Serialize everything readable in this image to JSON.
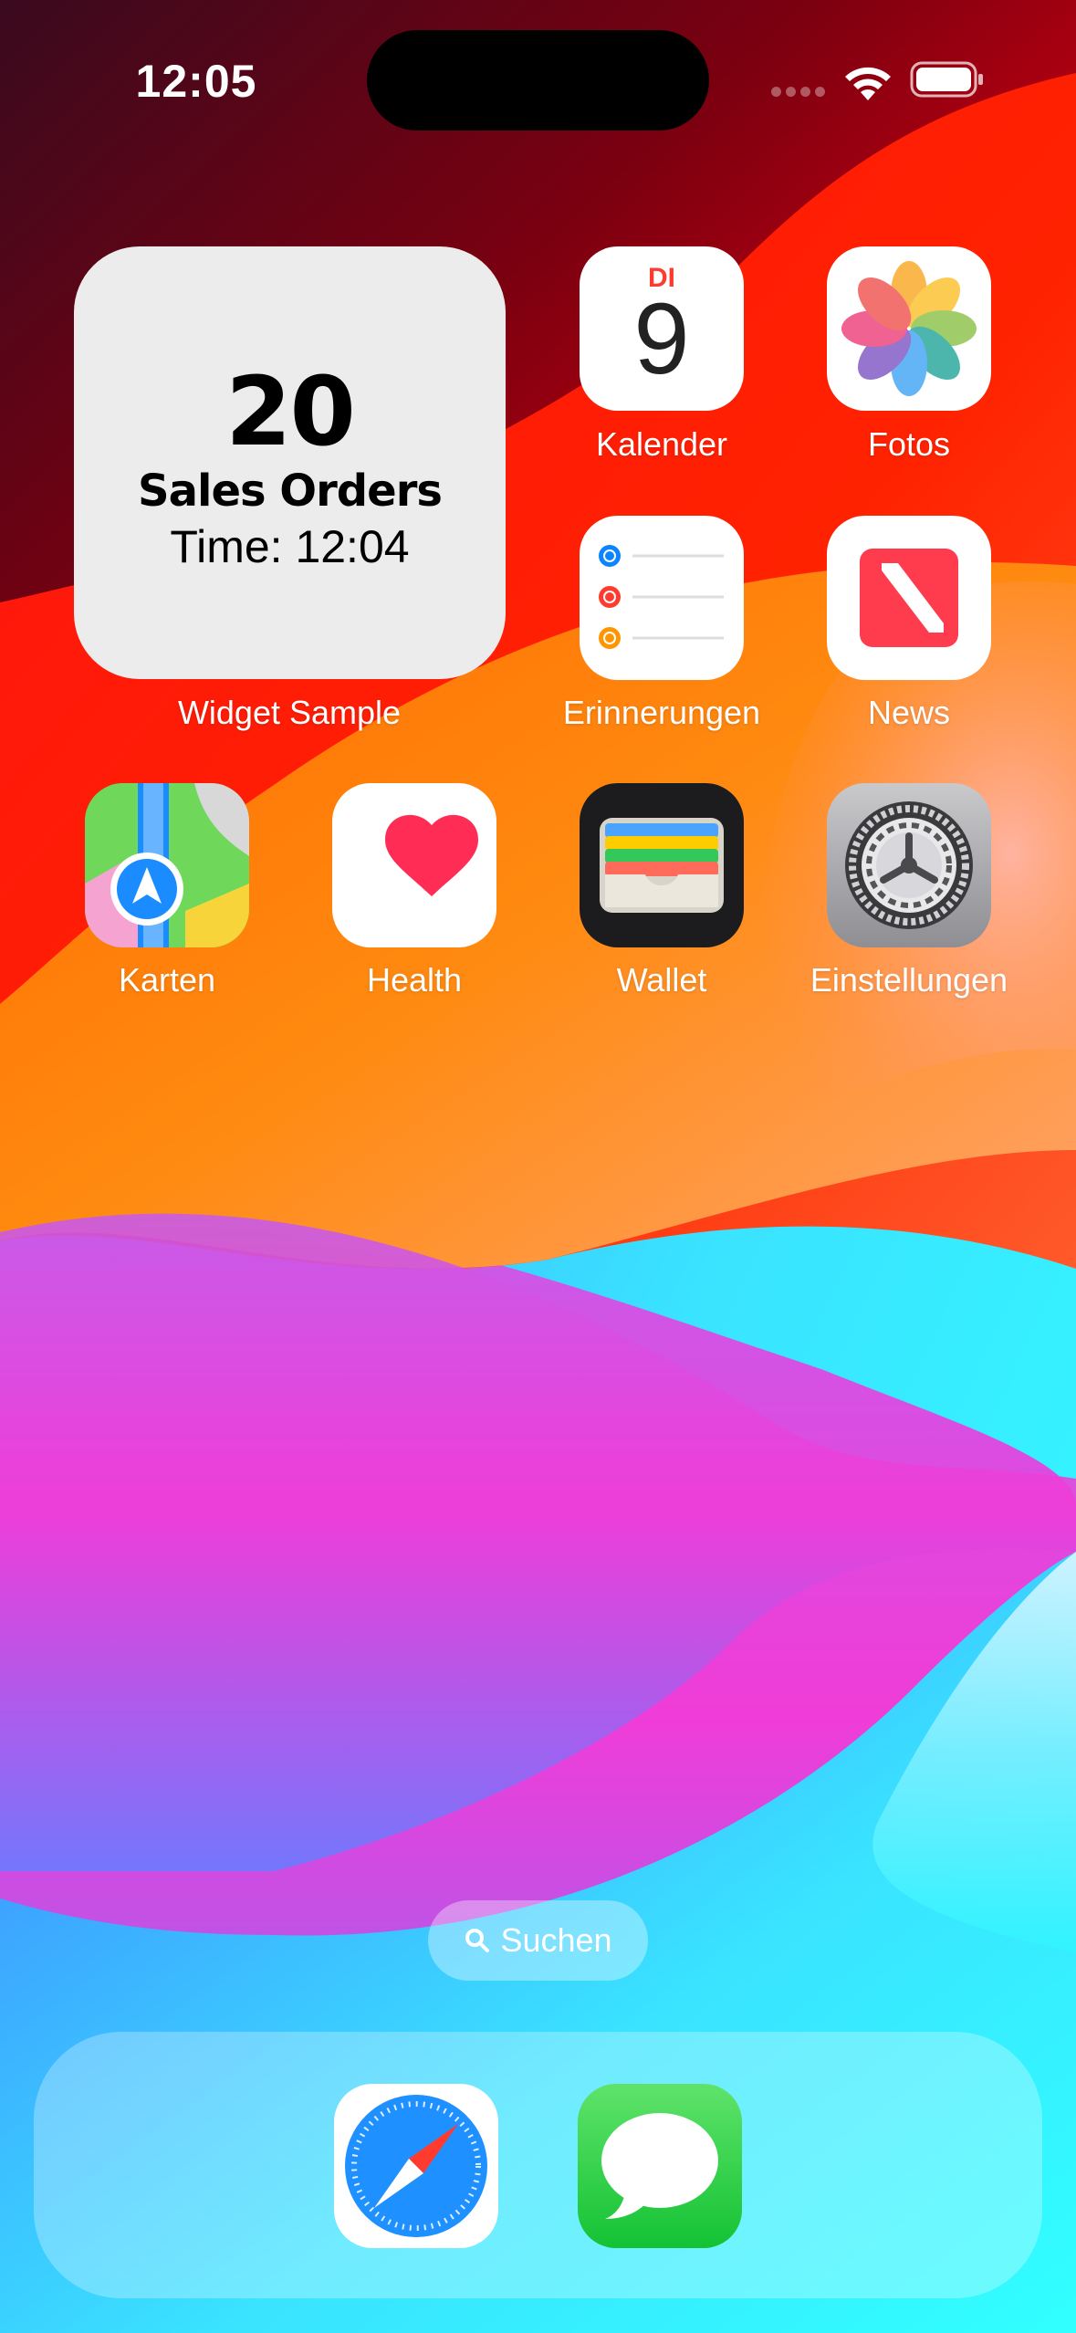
{
  "status_bar": {
    "time": "12:05"
  },
  "widget": {
    "count": "20",
    "title": "Sales Orders",
    "time_text": "Time: 12:04",
    "label": "Widget Sample"
  },
  "apps": {
    "calendar": {
      "label": "Kalender",
      "weekday": "DI",
      "day": "9"
    },
    "photos": {
      "label": "Fotos"
    },
    "reminders": {
      "label": "Erinnerungen"
    },
    "news": {
      "label": "News"
    },
    "maps": {
      "label": "Karten"
    },
    "health": {
      "label": "Health"
    },
    "wallet": {
      "label": "Wallet"
    },
    "settings": {
      "label": "Einstellungen"
    }
  },
  "search": {
    "label": "Suchen"
  },
  "dock": {
    "apps": [
      {
        "name": "Safari",
        "icon": "safari-icon"
      },
      {
        "name": "Messages",
        "icon": "messages-icon"
      }
    ]
  },
  "colors": {
    "calendar_red": "#ff3b30",
    "messages_green": "#34c759",
    "safari_blue": "#1e90ff"
  }
}
